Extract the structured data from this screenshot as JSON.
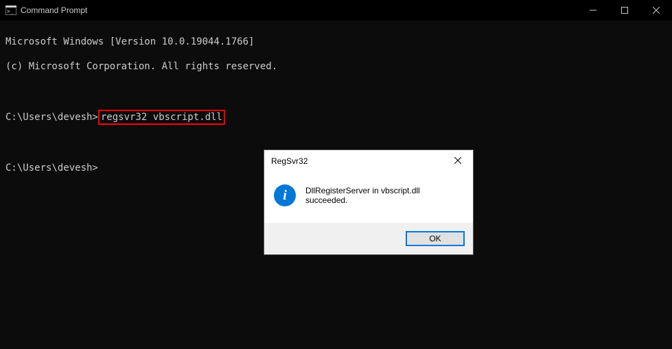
{
  "window": {
    "title": "Command Prompt"
  },
  "terminal": {
    "line1": "Microsoft Windows [Version 10.0.19044.1766]",
    "line2": "(c) Microsoft Corporation. All rights reserved.",
    "prompt1_prefix": "C:\\Users\\devesh>",
    "prompt1_command": "regsvr32 vbscript.dll",
    "prompt2": "C:\\Users\\devesh>"
  },
  "dialog": {
    "title": "RegSvr32",
    "message": "DllRegisterServer in vbscript.dll succeeded.",
    "ok_label": "OK"
  }
}
